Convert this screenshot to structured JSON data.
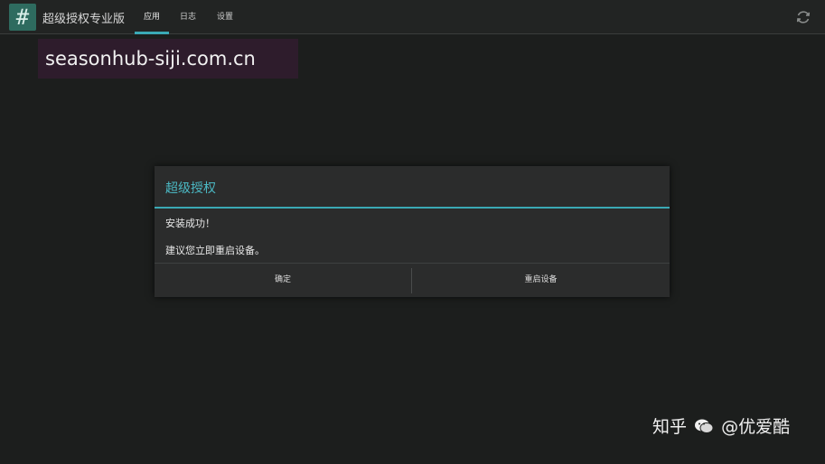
{
  "app": {
    "title": "超级授权专业版",
    "icon_glyph": "#",
    "icon_name": "hash-icon"
  },
  "tabs": [
    {
      "label": "应用",
      "active": true
    },
    {
      "label": "日志",
      "active": false
    },
    {
      "label": "设置",
      "active": false
    }
  ],
  "toolbar": {
    "refresh_icon": "refresh-icon"
  },
  "overlay": {
    "site_watermark": "seasonhub-siji.com.cn",
    "credit_prefix": "知乎",
    "credit_suffix": "@优爱酷"
  },
  "dialog": {
    "title": "超级授权",
    "message_line1": "安装成功！",
    "message_line2": "建议您立即重启设备。",
    "ok_label": "确定",
    "reboot_label": "重启设备"
  },
  "colors": {
    "accent": "#3aa9b5",
    "background": "#1c1e1d",
    "dialog_bg": "#2b2c2c"
  }
}
